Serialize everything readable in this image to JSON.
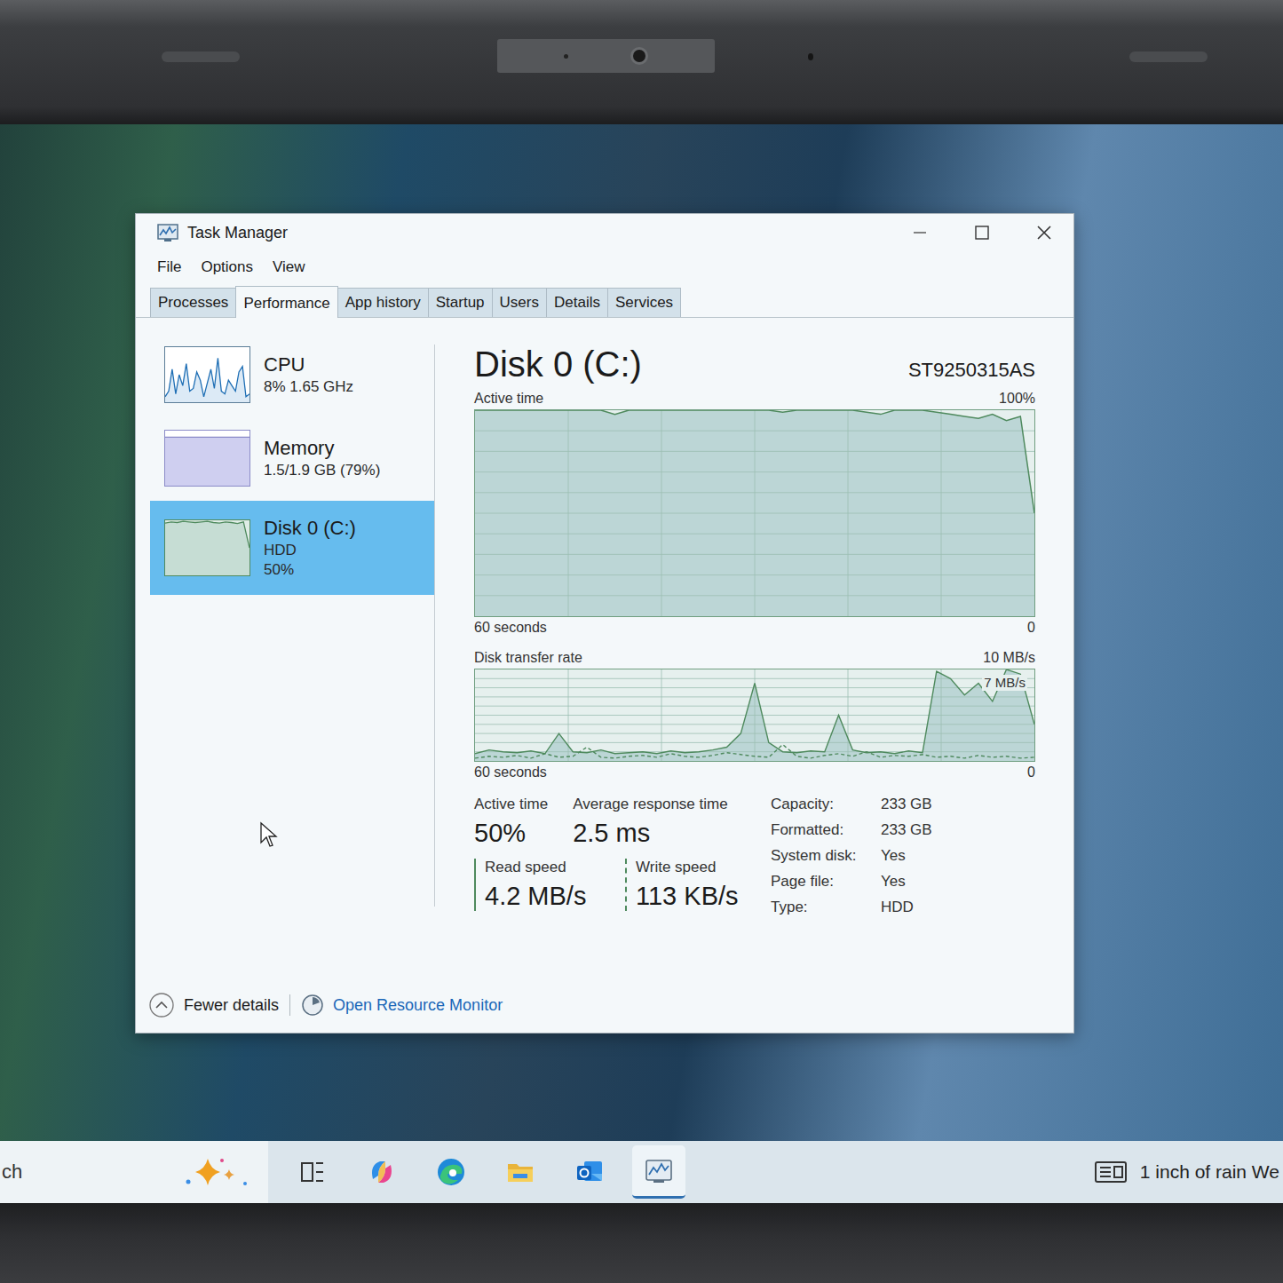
{
  "window": {
    "title": "Task Manager"
  },
  "menu": [
    "File",
    "Options",
    "View"
  ],
  "tabs": [
    {
      "label": "Processes",
      "selected": false
    },
    {
      "label": "Performance",
      "selected": true
    },
    {
      "label": "App history",
      "selected": false
    },
    {
      "label": "Startup",
      "selected": false
    },
    {
      "label": "Users",
      "selected": false
    },
    {
      "label": "Details",
      "selected": false
    },
    {
      "label": "Services",
      "selected": false
    }
  ],
  "sidebar": {
    "items": [
      {
        "name": "CPU",
        "lines": [
          "8%  1.65 GHz"
        ],
        "selected": false,
        "kind": "cpu",
        "graph": [
          10,
          20,
          60,
          15,
          50,
          30,
          70,
          20,
          25,
          55,
          40,
          10,
          35,
          60,
          25,
          80,
          20,
          15,
          40,
          30,
          20,
          55,
          65,
          10,
          15
        ]
      },
      {
        "name": "Memory",
        "lines": [
          "1.5/1.9 GB (79%)"
        ],
        "selected": false,
        "kind": "memory",
        "graph": [
          88,
          88,
          88,
          88,
          88,
          88,
          88,
          88,
          88,
          88
        ]
      },
      {
        "name": "Disk 0 (C:)",
        "lines": [
          "HDD",
          "50%"
        ],
        "selected": true,
        "kind": "disk",
        "graph": [
          95,
          97,
          96,
          98,
          97,
          96,
          97,
          98,
          96,
          95,
          97,
          96,
          94,
          97,
          50
        ]
      }
    ]
  },
  "panel": {
    "title": "Disk 0 (C:)",
    "model": "ST9250315AS"
  },
  "active_chart": {
    "label": "Active time",
    "max_label": "100%",
    "span_label": "60 seconds",
    "min_label": "0",
    "max": 100,
    "values": [
      100,
      100,
      100,
      100,
      100,
      100,
      100,
      100,
      100,
      100,
      98,
      100,
      100,
      100,
      100,
      100,
      100,
      100,
      100,
      100,
      100,
      100,
      99,
      100,
      100,
      100,
      100,
      100,
      99,
      98,
      100,
      100,
      100,
      99,
      98,
      97,
      96,
      98,
      95,
      97,
      50
    ]
  },
  "transfer_chart": {
    "label": "Disk transfer rate",
    "max_label": "10 MB/s",
    "peak_label": "7 MB/s",
    "span_label": "60 seconds",
    "min_label": "0",
    "max": 10,
    "series": [
      {
        "kind": "solid",
        "values": [
          0.8,
          1.2,
          1.0,
          0.9,
          1.1,
          0.8,
          3.0,
          1.0,
          0.9,
          1.2,
          0.8,
          0.9,
          1.0,
          0.8,
          1.1,
          0.9,
          1.0,
          1.2,
          1.5,
          3.0,
          8.5,
          2.0,
          1.0,
          0.9,
          1.1,
          1.0,
          5.0,
          1.2,
          0.9,
          1.0,
          0.8,
          1.1,
          0.9,
          9.8,
          9.0,
          7.2,
          8.5,
          6.5,
          10,
          9.5,
          4.0
        ]
      },
      {
        "kind": "dashed",
        "values": [
          0.3,
          0.5,
          0.4,
          0.6,
          0.3,
          0.8,
          0.4,
          0.5,
          1.5,
          0.4,
          0.3,
          0.5,
          0.6,
          0.4,
          0.8,
          0.5,
          0.4,
          0.6,
          0.9,
          0.7,
          0.5,
          0.4,
          1.8,
          0.5,
          0.3,
          0.6,
          0.8,
          0.5,
          1.0,
          0.4,
          0.6,
          0.5,
          0.7,
          0.4,
          0.5,
          0.3,
          0.6,
          0.4,
          0.5,
          0.3,
          0.4
        ]
      }
    ]
  },
  "stats": [
    {
      "label": "Active time",
      "value": "50%"
    },
    {
      "label": "Average response time",
      "value": "2.5 ms"
    }
  ],
  "speeds": [
    {
      "label": "Read speed",
      "value": "4.2 MB/s",
      "kind": "solid"
    },
    {
      "label": "Write speed",
      "value": "113 KB/s",
      "kind": "dashed"
    }
  ],
  "properties": [
    {
      "label": "Capacity:",
      "value": "233 GB"
    },
    {
      "label": "Formatted:",
      "value": "233 GB"
    },
    {
      "label": "System disk:",
      "value": "Yes"
    },
    {
      "label": "Page file:",
      "value": "Yes"
    },
    {
      "label": "Type:",
      "value": "HDD"
    }
  ],
  "footer": {
    "fewer": "Fewer details",
    "monitor": "Open Resource Monitor"
  },
  "taskbar": {
    "search": "ch",
    "apps": [
      {
        "kind": "task-view",
        "selected": false
      },
      {
        "kind": "copilot",
        "selected": false
      },
      {
        "kind": "edge",
        "selected": false
      },
      {
        "kind": "explorer",
        "selected": false
      },
      {
        "kind": "outlook",
        "selected": false
      },
      {
        "kind": "taskmanager",
        "selected": true
      }
    ],
    "weather": "1 inch of rain We"
  }
}
